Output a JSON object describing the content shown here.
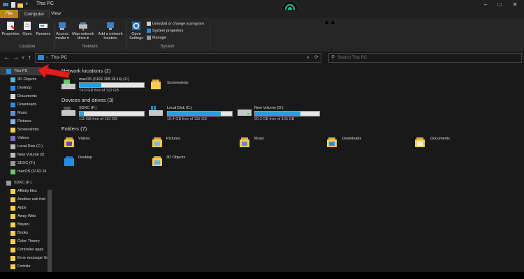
{
  "window": {
    "title": "This PC"
  },
  "tabs": {
    "file": "File",
    "computer": "Computer",
    "view": "View"
  },
  "ribbon": {
    "location": {
      "properties": "Properties",
      "open": "Open",
      "rename": "Rename",
      "label": "Location"
    },
    "network": {
      "access_media": "Access media",
      "map_drive": "Map network drive",
      "add_location": "Add a network location",
      "label": "Network"
    },
    "system": {
      "open_settings": "Open Settings",
      "uninstall": "Uninstall or change a program",
      "system_properties": "System properties",
      "manage": "Manage",
      "label": "System"
    }
  },
  "address": {
    "crumb": "This PC",
    "search_placeholder": "Search This PC"
  },
  "sidebar": {
    "items": [
      "This PC",
      "3D Objects",
      "Desktop",
      "Documents",
      "Downloads",
      "Music",
      "Pictures",
      "Screenshots",
      "Videos",
      "Local Disk (C:)",
      "New Volume (D:",
      "SDXC (F:)",
      "macOS (\\\\192.16",
      "SDXC (F:)",
      "Affinity files",
      "Another sub fold",
      "Apps",
      "Away Web",
      "Biryani",
      "Books",
      "Color Theory",
      "Controller apps",
      "Error message Sc",
      "Fortnite"
    ]
  },
  "main": {
    "network_header": "Network locations (2)",
    "network": [
      {
        "name": "macOS (\\\\192.168.18.14) (Z:)",
        "free": "74.0 GB free of 112 GB",
        "used_fraction": 0.34
      },
      {
        "name": "Screenshots"
      }
    ],
    "devices_header": "Devices and drives (3)",
    "drives": [
      {
        "name": "SDXC (F:)",
        "free": "111 GB free of 119 GB",
        "used_fraction": 0.07
      },
      {
        "name": "Local Disk (C:)",
        "free": "19.4 GB free of 115 GB",
        "used_fraction": 0.83
      },
      {
        "name": "New Volume (D:)",
        "free": "30.3 GB free of 105 GB",
        "used_fraction": 0.71
      }
    ],
    "folders_header": "Folders (7)",
    "folders": [
      "Videos",
      "Pictures",
      "Music",
      "Downloads",
      "Documents",
      "Desktop",
      "3D Objects"
    ]
  },
  "colors": {
    "accent": "#26a0da",
    "file_tab": "#b8860b",
    "arrow": "#e01e1e"
  }
}
